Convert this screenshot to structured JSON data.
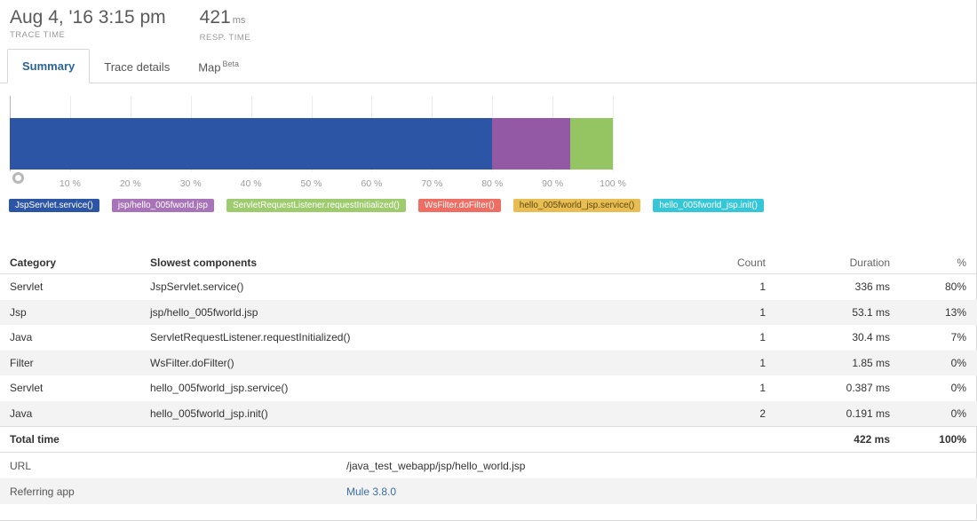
{
  "header": {
    "trace_time_value": "Aug 4, '16 3:15 pm",
    "trace_time_label": "TRACE TIME",
    "resp_time_value": "421",
    "resp_time_unit": "ms",
    "resp_time_label": "RESP. TIME"
  },
  "tabs": [
    {
      "label": "Summary",
      "active": true
    },
    {
      "label": "Trace details",
      "active": false
    },
    {
      "label": "Map",
      "badge": "Beta",
      "active": false
    }
  ],
  "chart_data": {
    "type": "bar",
    "orientation": "horizontal-stacked",
    "title": "",
    "xlabel": "",
    "ylabel": "",
    "xlim": [
      0,
      100
    ],
    "grid": true,
    "legend_position": "bottom",
    "tick_labels": [
      "10 %",
      "20 %",
      "30 %",
      "40 %",
      "50 %",
      "60 %",
      "70 %",
      "80 %",
      "90 %",
      "100 %"
    ],
    "tick_values": [
      10,
      20,
      30,
      40,
      50,
      60,
      70,
      80,
      90,
      100
    ],
    "segments": [
      {
        "name": "JspServlet.service()",
        "value": 80,
        "color": "#2d55a5",
        "legend_bg": "#2d55a5",
        "legend_fg": "#ffffff"
      },
      {
        "name": "jsp/hello_005fworld.jsp",
        "value": 13,
        "color": "#9459a5",
        "legend_bg": "#a873b8",
        "legend_fg": "#ffffff"
      },
      {
        "name": "ServletRequestListener.requestInitialized()",
        "value": 7,
        "color": "#95c563",
        "legend_bg": "#9ecb6d",
        "legend_fg": "#ffffff"
      },
      {
        "name": "WsFilter.doFilter()",
        "value": 0,
        "color": "#ef6e63",
        "legend_bg": "#ef6e63",
        "legend_fg": "#ffffff"
      },
      {
        "name": "hello_005fworld_jsp.service()",
        "value": 0,
        "color": "#e8bd52",
        "legend_bg": "#e8bd52",
        "legend_fg": "#5d4a14"
      },
      {
        "name": "hello_005fworld_jsp.init()",
        "value": 0,
        "color": "#35c6d8",
        "legend_bg": "#35c6d8",
        "legend_fg": "#ffffff"
      }
    ]
  },
  "table": {
    "headers": {
      "category": "Category",
      "component": "Slowest components",
      "count": "Count",
      "duration": "Duration",
      "percent": "%"
    },
    "rows": [
      {
        "category": "Servlet",
        "component": "JspServlet.service()",
        "count": "1",
        "duration": "336 ms",
        "percent": "80%"
      },
      {
        "category": "Jsp",
        "component": "jsp/hello_005fworld.jsp",
        "count": "1",
        "duration": "53.1 ms",
        "percent": "13%"
      },
      {
        "category": "Java",
        "component": "ServletRequestListener.requestInitialized()",
        "count": "1",
        "duration": "30.4 ms",
        "percent": "7%"
      },
      {
        "category": "Filter",
        "component": "WsFilter.doFilter()",
        "count": "1",
        "duration": "1.85 ms",
        "percent": "0%"
      },
      {
        "category": "Servlet",
        "component": "hello_005fworld_jsp.service()",
        "count": "1",
        "duration": "0.387 ms",
        "percent": "0%"
      },
      {
        "category": "Java",
        "component": "hello_005fworld_jsp.init()",
        "count": "2",
        "duration": "0.191 ms",
        "percent": "0%"
      }
    ],
    "total": {
      "label": "Total time",
      "count": "",
      "duration": "422 ms",
      "percent": "100%"
    }
  },
  "meta": [
    {
      "key": "URL",
      "value": "/java_test_webapp/jsp/hello_world.jsp",
      "link": false
    },
    {
      "key": "Referring app",
      "value": "Mule 3.8.0",
      "link": true
    }
  ]
}
